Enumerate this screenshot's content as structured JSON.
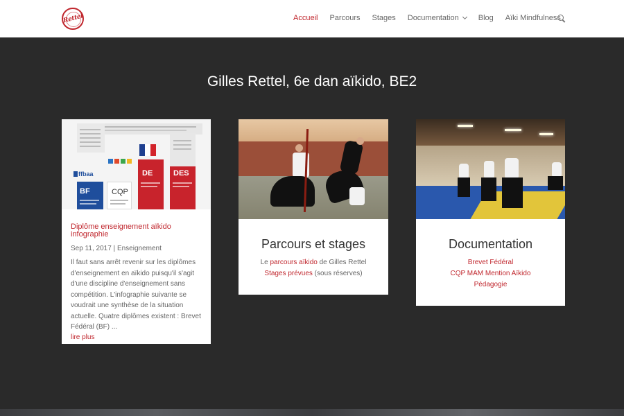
{
  "header": {
    "logo_text": "Rettel",
    "nav": [
      {
        "label": "Accueil",
        "active": true,
        "dropdown": false
      },
      {
        "label": "Parcours",
        "active": false,
        "dropdown": false
      },
      {
        "label": "Stages",
        "active": false,
        "dropdown": false
      },
      {
        "label": "Documentation",
        "active": false,
        "dropdown": true
      },
      {
        "label": "Blog",
        "active": false,
        "dropdown": false
      },
      {
        "label": "Aïki Mindfulness",
        "active": false,
        "dropdown": false
      }
    ],
    "search_icon": "search-icon"
  },
  "page": {
    "title": "Gilles Rettel, 6e dan aïkido, BE2"
  },
  "post_card": {
    "infographic": {
      "bf": "BF",
      "cqp": "CQP",
      "de": "DE",
      "des": "DES",
      "ffbaa": "ffbaa",
      "cqp_logo": "CHEF"
    },
    "title": "Diplôme enseignement aïkido infographie",
    "date": "Sep 11, 2017",
    "separator": "|",
    "category": "Enseignement",
    "excerpt": "Il faut sans arrêt revenir sur les diplômes d'enseignement en aïkido puisqu'il s'agit d'une discipline d'enseignement sans compétition. L'infographie suivante se voudrait une synthèse de la situation actuelle. Quatre diplômes existent : Brevet Fédéral (BF) ...",
    "read_more": "lire plus"
  },
  "parcours_card": {
    "heading": "Parcours et stages",
    "line1_prefix": "Le ",
    "line1_link": "parcours aïkido",
    "line1_suffix": " de Gilles Rettel",
    "line2_link": "Stages prévues",
    "line2_suffix": " (sous réserves)"
  },
  "documentation_card": {
    "heading": "Documentation",
    "links": [
      "Brevet Fédéral",
      "CQP MAM Mention Aïkido",
      "Pédagogie"
    ]
  },
  "colors": {
    "accent": "#c0262d",
    "background": "#2a2a2a",
    "text": "#666666",
    "heading": "#333333"
  }
}
